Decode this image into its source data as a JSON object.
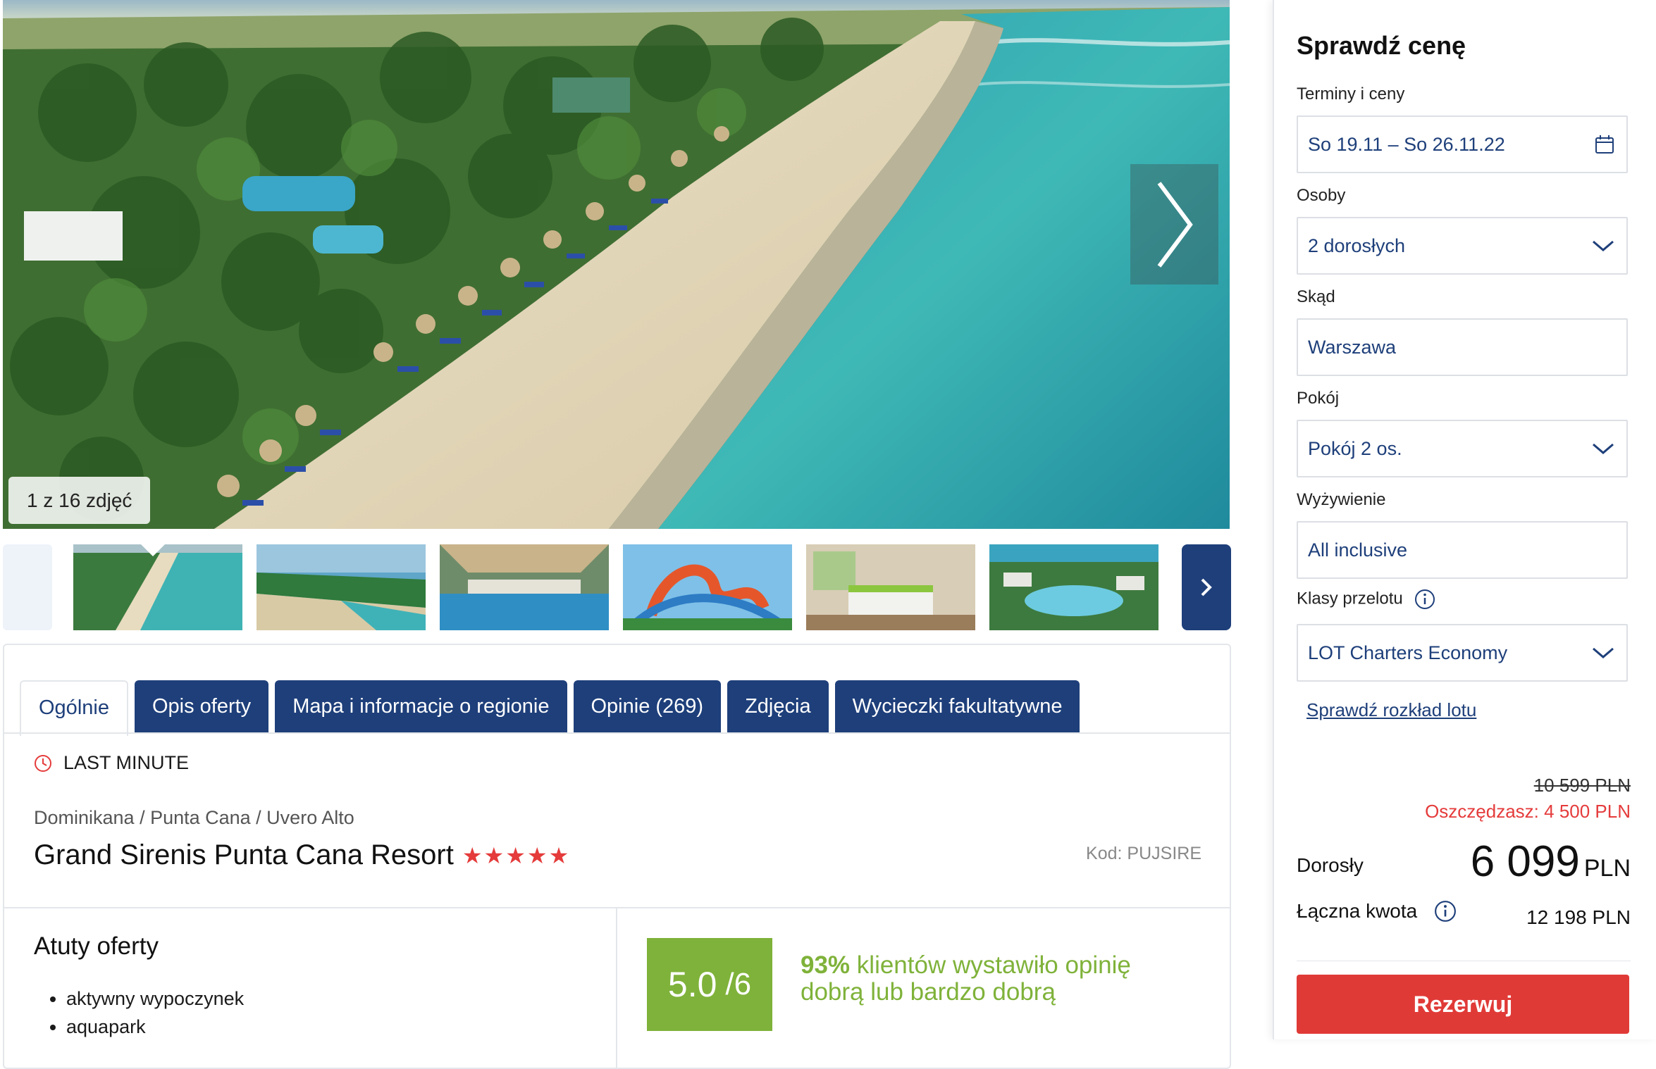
{
  "gallery": {
    "counter": "1 z 16 zdjęć",
    "next_icon": "chevron-right-icon",
    "thumbnails": [
      "beach-aerial",
      "beach-shore",
      "pool-bar",
      "water-slides",
      "hotel-room",
      "resort-aerial"
    ]
  },
  "tabs": [
    "Ogólnie",
    "Opis oferty",
    "Mapa i informacje o regionie",
    "Opinie (269)",
    "Zdjęcia",
    "Wycieczki fakultatywne"
  ],
  "offer": {
    "badge": "LAST MINUTE",
    "breadcrumb": "Dominikana / Punta Cana / Uvero Alto",
    "hotel_name": "Grand Sirenis Punta Cana Resort",
    "stars": "★★★★★",
    "code": "Kod: PUJSIRE"
  },
  "highlights": {
    "title": "Atuty oferty",
    "items": [
      "aktywny wypoczynek",
      "aquapark"
    ]
  },
  "rating": {
    "score": "5.0",
    "scale": "/6",
    "percent": "93%",
    "text": " klientów wystawiło opinię dobrą lub bardzo dobrą"
  },
  "booking": {
    "title": "Sprawdź cenę",
    "dates_label": "Terminy i ceny",
    "dates_value": "So 19.11 – So 26.11.22",
    "persons_label": "Osoby",
    "persons_value": "2 dorosłych",
    "from_label": "Skąd",
    "from_value": "Warszawa",
    "room_label": "Pokój",
    "room_value": "Pokój 2 os.",
    "board_label": "Wyżywienie",
    "board_value": "All inclusive",
    "class_label": "Klasy przelotu",
    "class_value": "LOT Charters Economy",
    "schedule_link": "Sprawdź rozkład lotu",
    "old_price": "10 599 PLN",
    "savings": "Oszczędzasz: 4 500 PLN",
    "adult_label": "Dorosły",
    "adult_price": "6 099",
    "currency": "PLN",
    "total_label": "Łączna kwota",
    "total_value": "12 198 PLN",
    "book_button": "Rezerwuj"
  },
  "colors": {
    "navy": "#1e3f7a",
    "red": "#e53b3b",
    "green": "#7fb23a",
    "button": "#e03a37"
  }
}
